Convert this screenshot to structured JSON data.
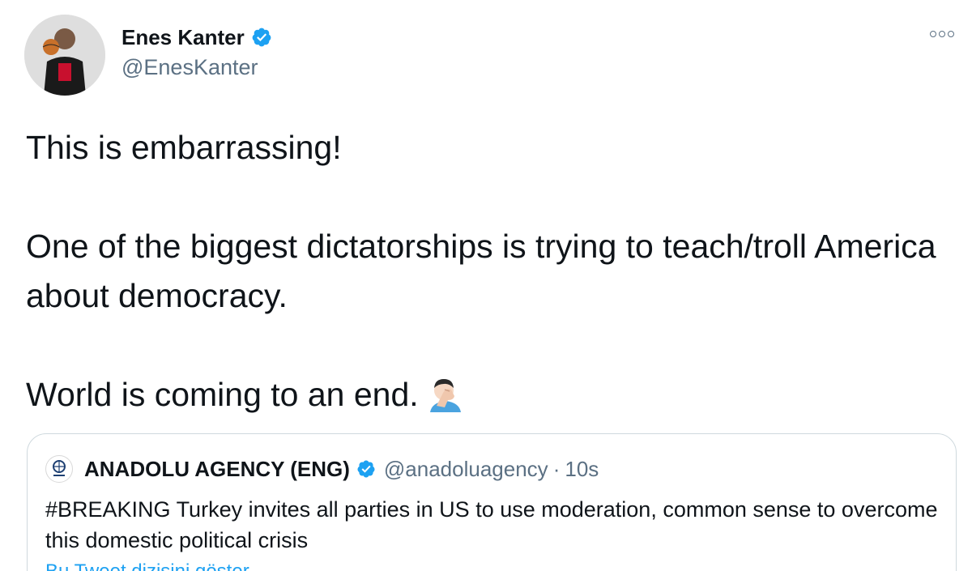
{
  "author": {
    "display_name": "Enes Kanter",
    "handle": "@EnesKanter",
    "verified": true
  },
  "icons": {
    "verified": "verified-badge-icon",
    "more": "more-options-icon",
    "emoji": "man-facepalming-emoji"
  },
  "colors": {
    "accent": "#1da1f2",
    "secondary_text": "#5b7083",
    "border": "#cfd9de"
  },
  "tweet": {
    "line1": "This is embarrassing!",
    "line2": "One of the biggest dictatorships is trying to teach/troll America about democracy.",
    "line3": "World is coming to an end."
  },
  "quoted": {
    "name": "ANADOLU AGENCY (ENG)",
    "handle": "@anadoluagency",
    "separator": "·",
    "time": "10s",
    "text": "#BREAKING Turkey invites all parties in US to use moderation, common sense to overcome this domestic political crisis",
    "link_text": "Bu Tweet dizisini göster"
  }
}
